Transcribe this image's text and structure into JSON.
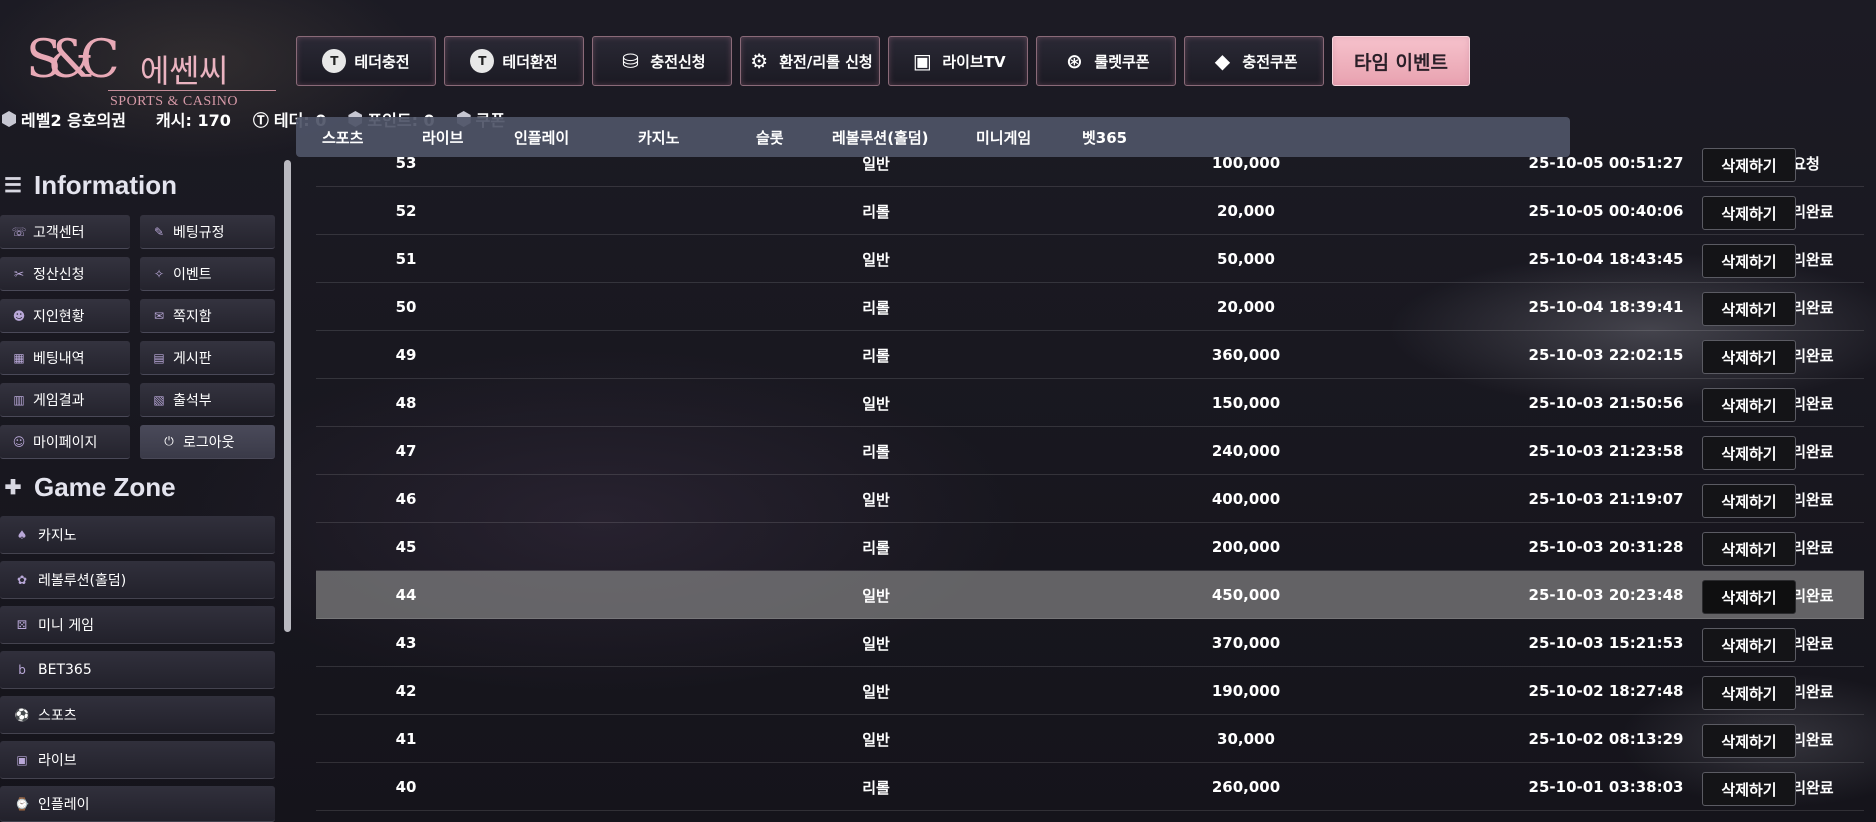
{
  "logo": {
    "mono": "S&C",
    "korean": "에쎈씨",
    "english": "SPORTS & CASINO"
  },
  "topnav": [
    {
      "label": "테더충전",
      "icon": "tether-coin-icon",
      "glyph": "T"
    },
    {
      "label": "테더환전",
      "icon": "tether-exchange-icon",
      "glyph": "T"
    },
    {
      "label": "충전신청",
      "icon": "coins-icon",
      "glyph": "⛁"
    },
    {
      "label": "환전/리롤 신청",
      "icon": "exchange-settings-icon",
      "glyph": "⚙"
    },
    {
      "label": "라이브TV",
      "icon": "live-tv-icon",
      "glyph": "▣"
    },
    {
      "label": "룰렛쿠폰",
      "icon": "roulette-icon",
      "glyph": "⊛"
    },
    {
      "label": "충전쿠폰",
      "icon": "coupon-ticket-icon",
      "glyph": "◆"
    },
    {
      "label": "타임 이벤트",
      "icon": "",
      "glyph": ""
    }
  ],
  "status": {
    "level": "레벨2 응호의권",
    "cash": "캐시: 170",
    "tether": "테더: 0",
    "points": "포인트: 0",
    "coupon": "쿠폰"
  },
  "categories": [
    "스포츠",
    "라이브",
    "인플레이",
    "카지노",
    "슬롯",
    "레볼루션(홀덤)",
    "미니게임",
    "벳365"
  ],
  "sidebar": {
    "info_title": "Information",
    "info_items": [
      {
        "label": "고객센터",
        "icon": "customer-service-icon",
        "glyph": "☏"
      },
      {
        "label": "베팅규정",
        "icon": "betting-rules-icon",
        "glyph": "✎"
      },
      {
        "label": "정산신청",
        "icon": "settlement-icon",
        "glyph": "✂"
      },
      {
        "label": "이벤트",
        "icon": "event-icon",
        "glyph": "✧"
      },
      {
        "label": "지인현황",
        "icon": "friends-icon",
        "glyph": "☻"
      },
      {
        "label": "쪽지함",
        "icon": "message-icon",
        "glyph": "✉"
      },
      {
        "label": "베팅내역",
        "icon": "betting-history-icon",
        "glyph": "▦"
      },
      {
        "label": "게시판",
        "icon": "board-icon",
        "glyph": "▤"
      },
      {
        "label": "게임결과",
        "icon": "game-results-icon",
        "glyph": "▥"
      },
      {
        "label": "출석부",
        "icon": "attendance-icon",
        "glyph": "▧"
      },
      {
        "label": "마이페이지",
        "icon": "my-page-icon",
        "glyph": "☺"
      },
      {
        "label": "로그아웃",
        "icon": "power-icon",
        "glyph": "⏻"
      }
    ],
    "game_title": "Game Zone",
    "game_items": [
      {
        "label": "카지노",
        "icon": "spade-icon",
        "glyph": "♠"
      },
      {
        "label": "레볼루션(홀덤)",
        "icon": "holdem-icon",
        "glyph": "✿"
      },
      {
        "label": "미니 게임",
        "icon": "dice-icon",
        "glyph": "⚄"
      },
      {
        "label": "BET365",
        "icon": "bet365-icon",
        "glyph": "b"
      },
      {
        "label": "스포츠",
        "icon": "sports-icon",
        "glyph": "⚽"
      },
      {
        "label": "라이브",
        "icon": "live-icon",
        "glyph": "▣"
      },
      {
        "label": "인플레이",
        "icon": "inplay-icon",
        "glyph": "⌚"
      }
    ]
  },
  "table": {
    "delete_label": "삭제하기",
    "rows": [
      {
        "id": "53",
        "type": "일반",
        "amount": "100,000",
        "date": "25-10-05 00:51:27",
        "status": "요청"
      },
      {
        "id": "52",
        "type": "리롤",
        "amount": "20,000",
        "date": "25-10-05 00:40:06",
        "status": "처리완료"
      },
      {
        "id": "51",
        "type": "일반",
        "amount": "50,000",
        "date": "25-10-04 18:43:45",
        "status": "처리완료"
      },
      {
        "id": "50",
        "type": "리롤",
        "amount": "20,000",
        "date": "25-10-04 18:39:41",
        "status": "처리완료"
      },
      {
        "id": "49",
        "type": "리롤",
        "amount": "360,000",
        "date": "25-10-03 22:02:15",
        "status": "처리완료"
      },
      {
        "id": "48",
        "type": "일반",
        "amount": "150,000",
        "date": "25-10-03 21:50:56",
        "status": "처리완료"
      },
      {
        "id": "47",
        "type": "리롤",
        "amount": "240,000",
        "date": "25-10-03 21:23:58",
        "status": "처리완료"
      },
      {
        "id": "46",
        "type": "일반",
        "amount": "400,000",
        "date": "25-10-03 21:19:07",
        "status": "처리완료"
      },
      {
        "id": "45",
        "type": "리롤",
        "amount": "200,000",
        "date": "25-10-03 20:31:28",
        "status": "처리완료"
      },
      {
        "id": "44",
        "type": "일반",
        "amount": "450,000",
        "date": "25-10-03 20:23:48",
        "status": "처리완료",
        "highlighted": true
      },
      {
        "id": "43",
        "type": "일반",
        "amount": "370,000",
        "date": "25-10-03 15:21:53",
        "status": "처리완료"
      },
      {
        "id": "42",
        "type": "일반",
        "amount": "190,000",
        "date": "25-10-02 18:27:48",
        "status": "처리완료"
      },
      {
        "id": "41",
        "type": "일반",
        "amount": "30,000",
        "date": "25-10-02 08:13:29",
        "status": "처리완료"
      },
      {
        "id": "40",
        "type": "리롤",
        "amount": "260,000",
        "date": "25-10-01 03:38:03",
        "status": "처리완료"
      }
    ]
  }
}
